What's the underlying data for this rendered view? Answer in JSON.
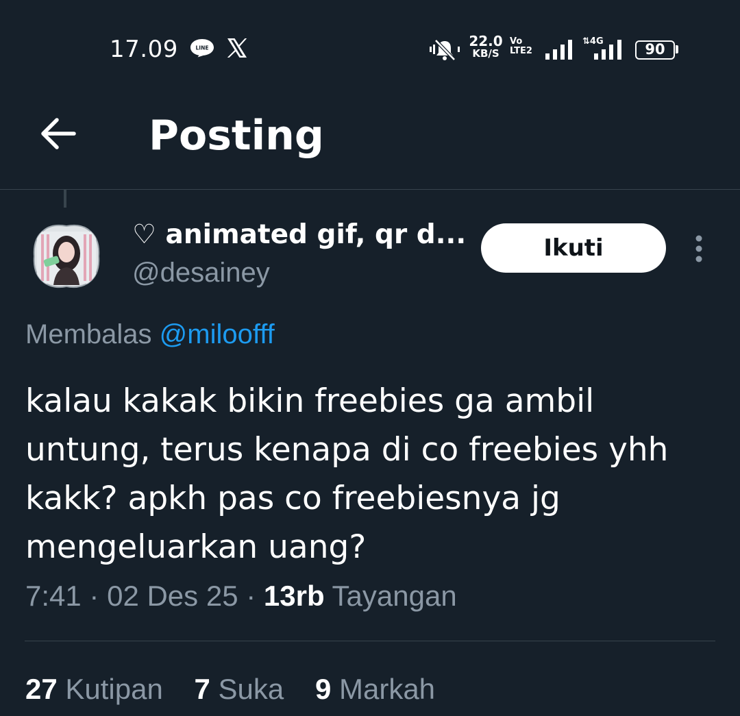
{
  "status_bar": {
    "time": "17.09",
    "notification_icons": [
      "line-app-icon",
      "x-app-icon"
    ],
    "network_speed_value": "22.0",
    "network_speed_unit": "KB/S",
    "volte_label_top": "Vo",
    "volte_label_bottom": "LTE2",
    "network_type": "4G",
    "battery_level": "90",
    "colors": {
      "text": "#ffffff"
    }
  },
  "header": {
    "back_icon": "arrow-left-icon",
    "title": "Posting"
  },
  "post": {
    "author": {
      "display_name": "♡ animated gif, qr d...",
      "handle": "@desainey",
      "avatar": "profile-avatar"
    },
    "follow_label": "Ikuti",
    "more_icon": "more-vertical-icon",
    "reply_prefix": "Membalas",
    "reply_mention": "@miloofff",
    "text": "kalau kakak bikin freebies ga ambil untung, terus kenapa di co freebies yhh kakk? apkh pas co freebiesnya jg mengeluarkan uang?",
    "time": "7:41",
    "date": "02 Des 25",
    "views_count": "13rb",
    "views_label": "Tayangan",
    "stats": {
      "quotes_count": "27",
      "quotes_label": "Kutipan",
      "likes_count": "7",
      "likes_label": "Suka",
      "bookmarks_count": "9",
      "bookmarks_label": "Markah"
    }
  },
  "colors": {
    "background": "#16202a",
    "secondary_text": "#8b98a5",
    "link": "#1d9bf0",
    "divider": "#38444d",
    "button_bg": "#ffffff",
    "button_text": "#0f1419"
  }
}
